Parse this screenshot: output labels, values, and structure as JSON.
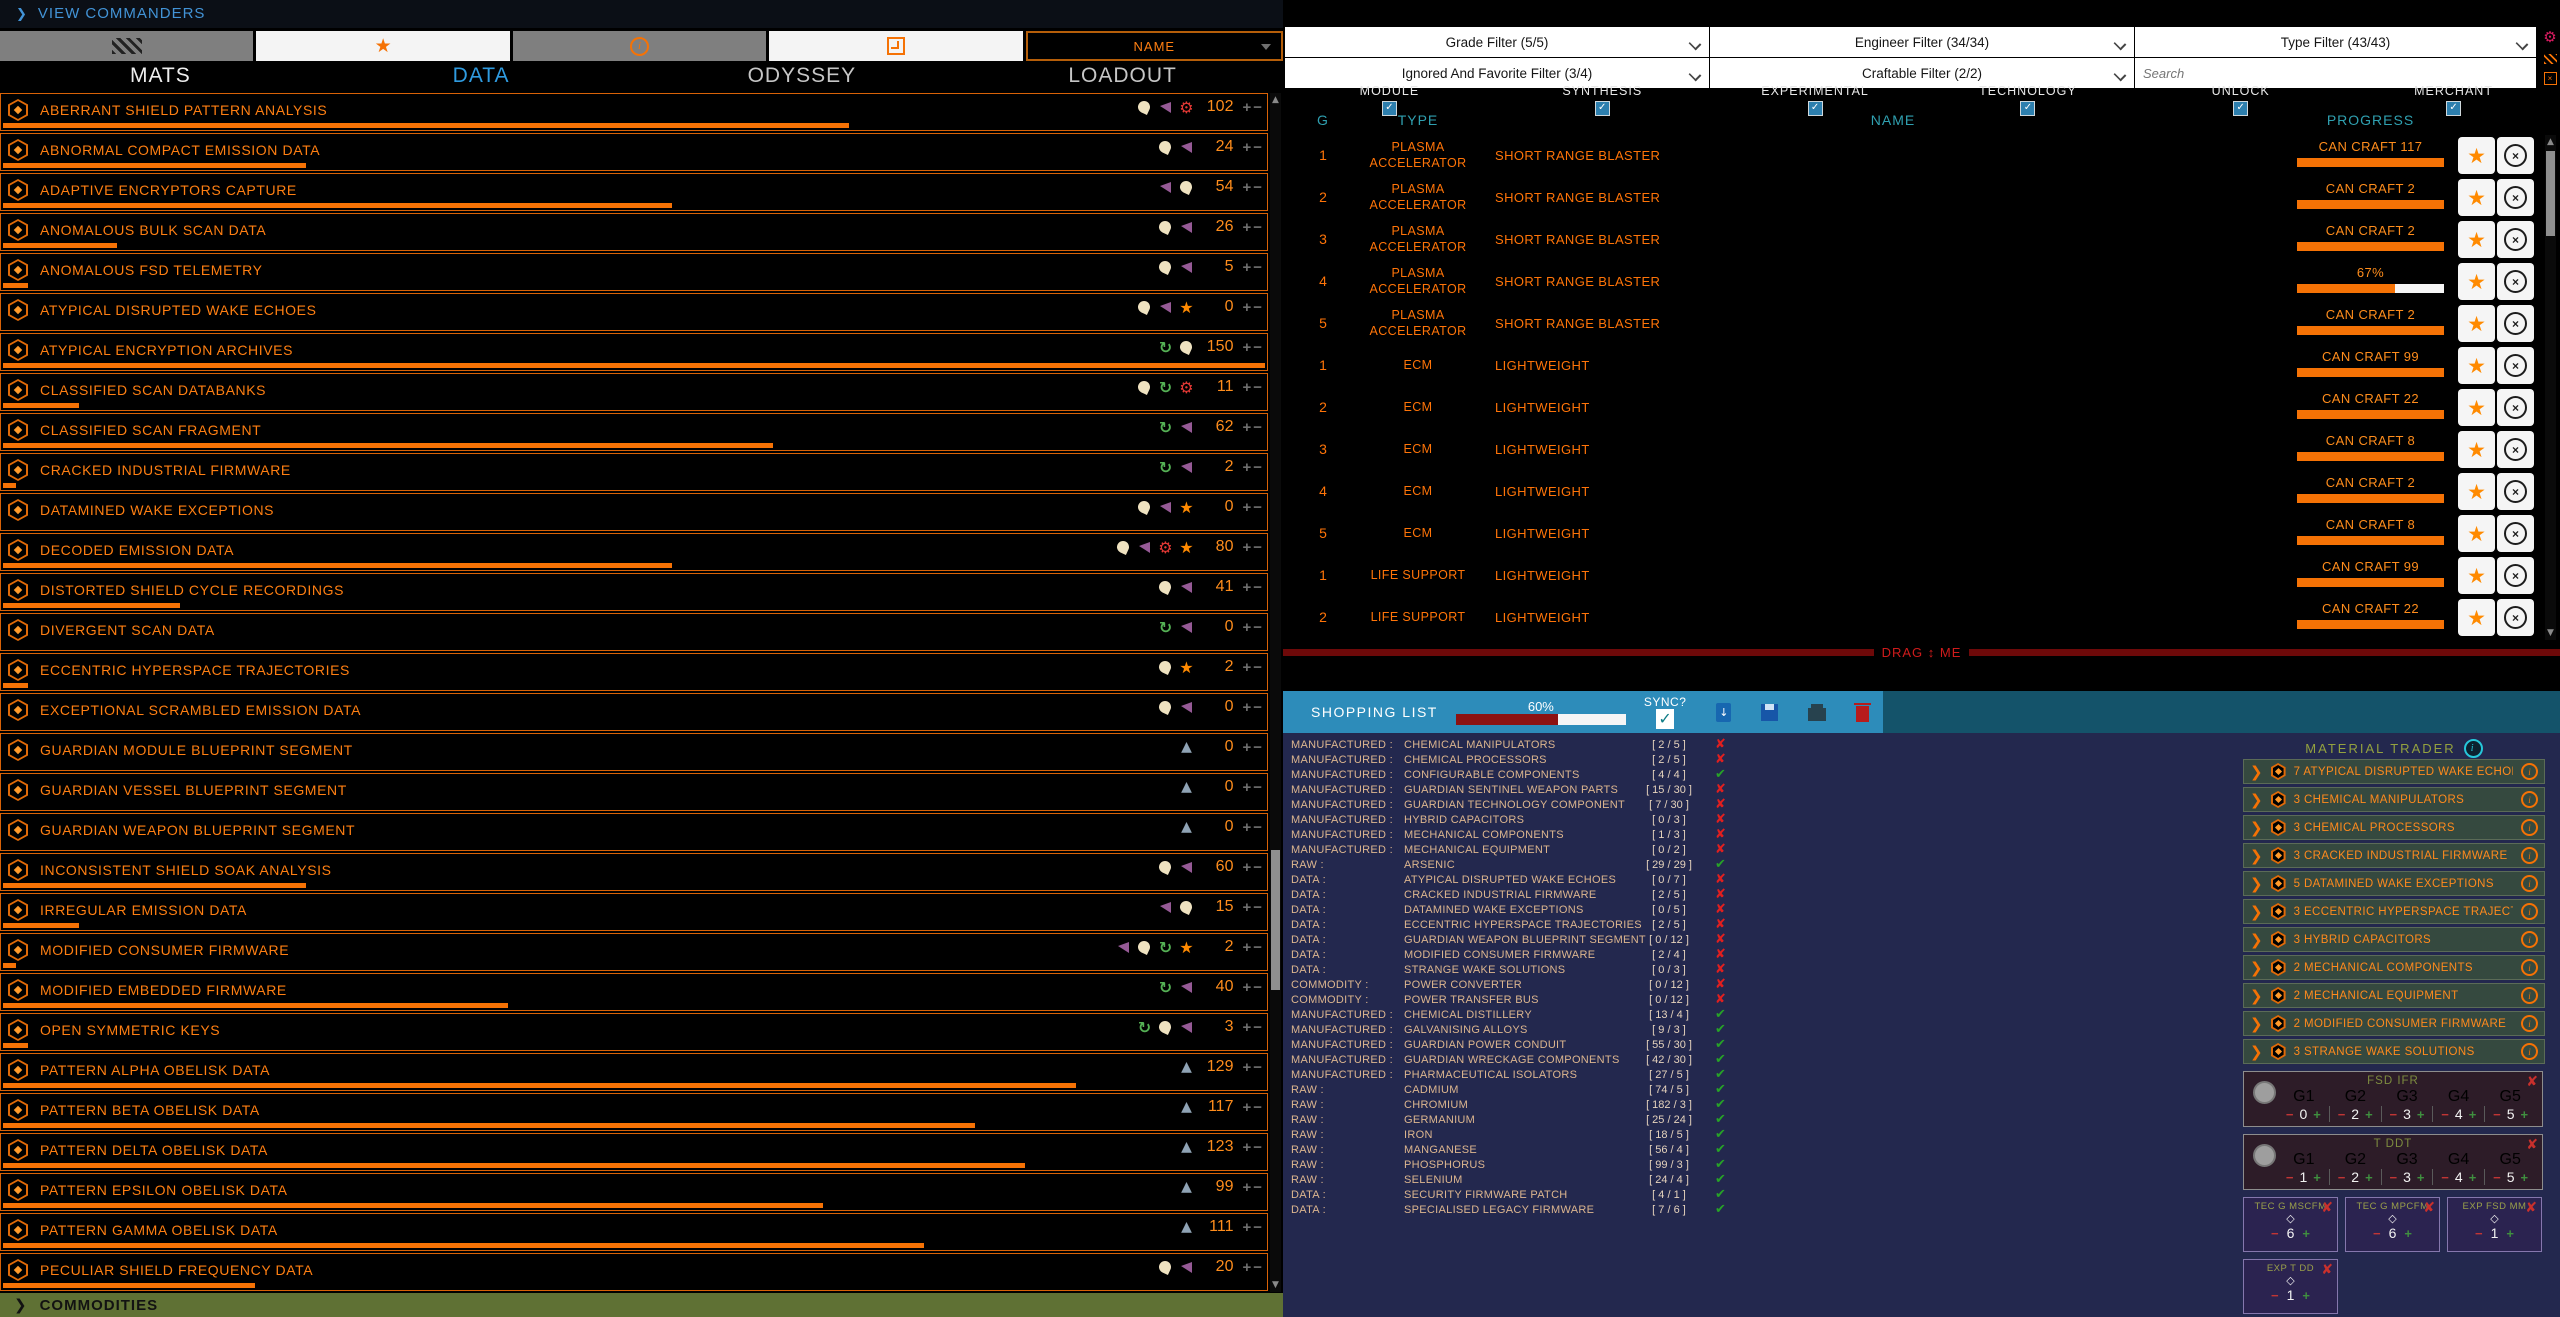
{
  "top": {
    "view_commanders": "VIEW COMMANDERS"
  },
  "toolbar": {
    "buttons": [
      {
        "icon": "hatch-icon"
      },
      {
        "icon": "star-icon"
      },
      {
        "icon": "info-icon"
      },
      {
        "icon": "box-icon"
      }
    ],
    "name_dropdown": "NAME"
  },
  "tabs": [
    {
      "label": "MATS",
      "active": false
    },
    {
      "label": "DATA",
      "active": true
    },
    {
      "label": "ODYSSEY",
      "active": false
    },
    {
      "label": "LOADOUT",
      "active": false
    }
  ],
  "materials": [
    {
      "name": "ABERRANT SHIELD PATTERN ANALYSIS",
      "icons": [
        "satellite",
        "flag",
        "gear"
      ],
      "count": 102,
      "progress": 67
    },
    {
      "name": "ABNORMAL COMPACT EMISSION DATA",
      "icons": [
        "satellite",
        "flag"
      ],
      "count": 24,
      "progress": 24
    },
    {
      "name": "ADAPTIVE ENCRYPTORS CAPTURE",
      "icons": [
        "flag",
        "satellite"
      ],
      "count": 54,
      "progress": 53
    },
    {
      "name": "ANOMALOUS BULK SCAN DATA",
      "icons": [
        "satellite",
        "flag"
      ],
      "count": 26,
      "progress": 9
    },
    {
      "name": "ANOMALOUS FSD TELEMETRY",
      "icons": [
        "satellite",
        "flag"
      ],
      "count": 5,
      "progress": 2
    },
    {
      "name": "ATYPICAL DISRUPTED WAKE ECHOES",
      "icons": [
        "satellite",
        "flag",
        "star"
      ],
      "count": 0,
      "progress": 0
    },
    {
      "name": "ATYPICAL ENCRYPTION ARCHIVES",
      "icons": [
        "trade",
        "satellite"
      ],
      "count": 150,
      "progress": 100
    },
    {
      "name": "CLASSIFIED SCAN DATABANKS",
      "icons": [
        "satellite",
        "trade",
        "gear"
      ],
      "count": 11,
      "progress": 6
    },
    {
      "name": "CLASSIFIED SCAN FRAGMENT",
      "icons": [
        "trade",
        "flag"
      ],
      "count": 62,
      "progress": 61
    },
    {
      "name": "CRACKED INDUSTRIAL FIRMWARE",
      "icons": [
        "trade",
        "flag"
      ],
      "count": 2,
      "progress": 1
    },
    {
      "name": "DATAMINED WAKE EXCEPTIONS",
      "icons": [
        "satellite",
        "flag",
        "star"
      ],
      "count": 0,
      "progress": 0
    },
    {
      "name": "DECODED EMISSION DATA",
      "icons": [
        "satellite",
        "flag",
        "gear",
        "star"
      ],
      "count": 80,
      "progress": 53
    },
    {
      "name": "DISTORTED SHIELD CYCLE RECORDINGS",
      "icons": [
        "satellite",
        "flag"
      ],
      "count": 41,
      "progress": 14
    },
    {
      "name": "DIVERGENT SCAN DATA",
      "icons": [
        "trade",
        "flag"
      ],
      "count": 0,
      "progress": 0
    },
    {
      "name": "ECCENTRIC HYPERSPACE TRAJECTORIES",
      "icons": [
        "satellite",
        "star"
      ],
      "count": 2,
      "progress": 2
    },
    {
      "name": "EXCEPTIONAL SCRAMBLED EMISSION DATA",
      "icons": [
        "satellite",
        "flag"
      ],
      "count": 0,
      "progress": 0
    },
    {
      "name": "GUARDIAN MODULE BLUEPRINT SEGMENT",
      "icons": [
        "guardian"
      ],
      "count": 0,
      "progress": 0
    },
    {
      "name": "GUARDIAN VESSEL BLUEPRINT SEGMENT",
      "icons": [
        "guardian"
      ],
      "count": 0,
      "progress": 0
    },
    {
      "name": "GUARDIAN WEAPON BLUEPRINT SEGMENT",
      "icons": [
        "guardian"
      ],
      "count": 0,
      "progress": 0
    },
    {
      "name": "INCONSISTENT SHIELD SOAK ANALYSIS",
      "icons": [
        "satellite",
        "flag"
      ],
      "count": 60,
      "progress": 24
    },
    {
      "name": "IRREGULAR EMISSION DATA",
      "icons": [
        "flag",
        "satellite"
      ],
      "count": 15,
      "progress": 6
    },
    {
      "name": "MODIFIED CONSUMER FIRMWARE",
      "icons": [
        "flag",
        "satellite",
        "trade",
        "star"
      ],
      "count": 2,
      "progress": 1
    },
    {
      "name": "MODIFIED EMBEDDED FIRMWARE",
      "icons": [
        "trade",
        "flag"
      ],
      "count": 40,
      "progress": 40
    },
    {
      "name": "OPEN SYMMETRIC KEYS",
      "icons": [
        "trade",
        "satellite",
        "flag"
      ],
      "count": 3,
      "progress": 2
    },
    {
      "name": "PATTERN ALPHA OBELISK DATA",
      "icons": [
        "guardian"
      ],
      "count": 129,
      "progress": 85
    },
    {
      "name": "PATTERN BETA OBELISK DATA",
      "icons": [
        "guardian"
      ],
      "count": 117,
      "progress": 77
    },
    {
      "name": "PATTERN DELTA OBELISK DATA",
      "icons": [
        "guardian"
      ],
      "count": 123,
      "progress": 81
    },
    {
      "name": "PATTERN EPSILON OBELISK DATA",
      "icons": [
        "guardian"
      ],
      "count": 99,
      "progress": 65
    },
    {
      "name": "PATTERN GAMMA OBELISK DATA",
      "icons": [
        "guardian"
      ],
      "count": 111,
      "progress": 73
    },
    {
      "name": "PECULIAR SHIELD FREQUENCY DATA",
      "icons": [
        "satellite",
        "flag"
      ],
      "count": 20,
      "progress": 20
    }
  ],
  "commodities_label": "COMMODITIES",
  "filters": {
    "grade": "Grade Filter (5/5)",
    "engineer": "Engineer Filter (34/34)",
    "type": "Type Filter (43/43)",
    "ignored": "Ignored And Favorite Filter (3/4)",
    "craftable": "Craftable Filter (2/2)",
    "search_placeholder": "Search"
  },
  "categories": [
    "MODULE",
    "SYNTHESIS",
    "EXPERIMENTAL",
    "TECHNOLOGY",
    "UNLOCK",
    "MERCHANT"
  ],
  "table": {
    "headers": {
      "g": "G",
      "type": "TYPE",
      "name": "NAME",
      "progress": "PROGRESS"
    },
    "rows": [
      {
        "g": "1",
        "type": "PLASMA ACCELERATOR",
        "subtype": "SHORT RANGE BLASTER",
        "name": "",
        "progress_label": "CAN CRAFT 117",
        "progress_pct": 100
      },
      {
        "g": "2",
        "type": "PLASMA ACCELERATOR",
        "subtype": "SHORT RANGE BLASTER",
        "name": "",
        "progress_label": "CAN CRAFT 2",
        "progress_pct": 100
      },
      {
        "g": "3",
        "type": "PLASMA ACCELERATOR",
        "subtype": "SHORT RANGE BLASTER",
        "name": "",
        "progress_label": "CAN CRAFT 2",
        "progress_pct": 100
      },
      {
        "g": "4",
        "type": "PLASMA ACCELERATOR",
        "subtype": "SHORT RANGE BLASTER",
        "name": "",
        "progress_label": "67%",
        "progress_pct": 67
      },
      {
        "g": "5",
        "type": "PLASMA ACCELERATOR",
        "subtype": "SHORT RANGE BLASTER",
        "name": "",
        "progress_label": "CAN CRAFT 2",
        "progress_pct": 100
      },
      {
        "g": "1",
        "type": "ECM",
        "subtype": "LIGHTWEIGHT",
        "name": "",
        "progress_label": "CAN CRAFT 99",
        "progress_pct": 100
      },
      {
        "g": "2",
        "type": "ECM",
        "subtype": "LIGHTWEIGHT",
        "name": "",
        "progress_label": "CAN CRAFT 22",
        "progress_pct": 100
      },
      {
        "g": "3",
        "type": "ECM",
        "subtype": "LIGHTWEIGHT",
        "name": "",
        "progress_label": "CAN CRAFT 8",
        "progress_pct": 100
      },
      {
        "g": "4",
        "type": "ECM",
        "subtype": "LIGHTWEIGHT",
        "name": "",
        "progress_label": "CAN CRAFT 2",
        "progress_pct": 100
      },
      {
        "g": "5",
        "type": "ECM",
        "subtype": "LIGHTWEIGHT",
        "name": "",
        "progress_label": "CAN CRAFT 8",
        "progress_pct": 100
      },
      {
        "g": "1",
        "type": "LIFE SUPPORT",
        "subtype": "LIGHTWEIGHT",
        "name": "",
        "progress_label": "CAN CRAFT 99",
        "progress_pct": 100
      },
      {
        "g": "2",
        "type": "LIFE SUPPORT",
        "subtype": "LIGHTWEIGHT",
        "name": "",
        "progress_label": "CAN CRAFT 22",
        "progress_pct": 100
      }
    ]
  },
  "splitter_label": "DRAG ↕ ME",
  "shopping": {
    "title": "SHOPPING LIST",
    "progress_label": "60%",
    "progress_pct": 60,
    "sync_label": "SYNC?",
    "items": [
      {
        "category": "MANUFACTURED :",
        "name": "CHEMICAL MANIPULATORS",
        "qty": "[ 2 / 5 ]",
        "ok": false
      },
      {
        "category": "MANUFACTURED :",
        "name": "CHEMICAL PROCESSORS",
        "qty": "[ 2 / 5 ]",
        "ok": false
      },
      {
        "category": "MANUFACTURED :",
        "name": "CONFIGURABLE COMPONENTS",
        "qty": "[ 4 / 4 ]",
        "ok": true
      },
      {
        "category": "MANUFACTURED :",
        "name": "GUARDIAN SENTINEL WEAPON PARTS",
        "qty": "[ 15 / 30 ]",
        "ok": false
      },
      {
        "category": "MANUFACTURED :",
        "name": "GUARDIAN TECHNOLOGY COMPONENT",
        "qty": "[ 7 / 30 ]",
        "ok": false
      },
      {
        "category": "MANUFACTURED :",
        "name": "HYBRID CAPACITORS",
        "qty": "[ 0 / 3 ]",
        "ok": false
      },
      {
        "category": "MANUFACTURED :",
        "name": "MECHANICAL COMPONENTS",
        "qty": "[ 1 / 3 ]",
        "ok": false
      },
      {
        "category": "MANUFACTURED :",
        "name": "MECHANICAL EQUIPMENT",
        "qty": "[ 0 / 2 ]",
        "ok": false
      },
      {
        "category": "RAW :",
        "name": "ARSENIC",
        "qty": "[ 29 / 29 ]",
        "ok": true
      },
      {
        "category": "DATA :",
        "name": "ATYPICAL DISRUPTED WAKE ECHOES",
        "qty": "[ 0 / 7 ]",
        "ok": false
      },
      {
        "category": "DATA :",
        "name": "CRACKED INDUSTRIAL FIRMWARE",
        "qty": "[ 2 / 5 ]",
        "ok": false
      },
      {
        "category": "DATA :",
        "name": "DATAMINED WAKE EXCEPTIONS",
        "qty": "[ 0 / 5 ]",
        "ok": false
      },
      {
        "category": "DATA :",
        "name": "ECCENTRIC HYPERSPACE TRAJECTORIES",
        "qty": "[ 2 / 5 ]",
        "ok": false
      },
      {
        "category": "DATA :",
        "name": "GUARDIAN WEAPON BLUEPRINT SEGMENT",
        "qty": "[ 0 / 12 ]",
        "ok": false
      },
      {
        "category": "DATA :",
        "name": "MODIFIED CONSUMER FIRMWARE",
        "qty": "[ 2 / 4 ]",
        "ok": false
      },
      {
        "category": "DATA :",
        "name": "STRANGE WAKE SOLUTIONS",
        "qty": "[ 0 / 3 ]",
        "ok": false
      },
      {
        "category": "COMMODITY :",
        "name": "POWER CONVERTER",
        "qty": "[ 0 / 12 ]",
        "ok": false
      },
      {
        "category": "COMMODITY :",
        "name": "POWER TRANSFER BUS",
        "qty": "[ 0 / 12 ]",
        "ok": false
      },
      {
        "category": "MANUFACTURED :",
        "name": "CHEMICAL DISTILLERY",
        "qty": "[ 13 / 4 ]",
        "ok": true
      },
      {
        "category": "MANUFACTURED :",
        "name": "GALVANISING ALLOYS",
        "qty": "[ 9 / 3 ]",
        "ok": true
      },
      {
        "category": "MANUFACTURED :",
        "name": "GUARDIAN POWER CONDUIT",
        "qty": "[ 55 / 30 ]",
        "ok": true
      },
      {
        "category": "MANUFACTURED :",
        "name": "GUARDIAN WRECKAGE COMPONENTS",
        "qty": "[ 42 / 30 ]",
        "ok": true
      },
      {
        "category": "MANUFACTURED :",
        "name": "PHARMACEUTICAL ISOLATORS",
        "qty": "[ 27 / 5 ]",
        "ok": true
      },
      {
        "category": "RAW :",
        "name": "CADMIUM",
        "qty": "[ 74 / 5 ]",
        "ok": true
      },
      {
        "category": "RAW :",
        "name": "CHROMIUM",
        "qty": "[ 182 / 3 ]",
        "ok": true
      },
      {
        "category": "RAW :",
        "name": "GERMANIUM",
        "qty": "[ 25 / 24 ]",
        "ok": true
      },
      {
        "category": "RAW :",
        "name": "IRON",
        "qty": "[ 18 / 5 ]",
        "ok": true
      },
      {
        "category": "RAW :",
        "name": "MANGANESE",
        "qty": "[ 56 / 4 ]",
        "ok": true
      },
      {
        "category": "RAW :",
        "name": "PHOSPHORUS",
        "qty": "[ 99 / 3 ]",
        "ok": true
      },
      {
        "category": "RAW :",
        "name": "SELENIUM",
        "qty": "[ 24 / 4 ]",
        "ok": true
      },
      {
        "category": "DATA :",
        "name": "SECURITY FIRMWARE PATCH",
        "qty": "[ 4 / 1 ]",
        "ok": true
      },
      {
        "category": "DATA :",
        "name": "SPECIALISED LEGACY FIRMWARE",
        "qty": "[ 7 / 6 ]",
        "ok": true
      }
    ]
  },
  "trader": {
    "title": "MATERIAL TRADER",
    "items": [
      {
        "count": "7",
        "name": "ATYPICAL DISRUPTED WAKE ECHOES"
      },
      {
        "count": "3",
        "name": "CHEMICAL MANIPULATORS"
      },
      {
        "count": "3",
        "name": "CHEMICAL PROCESSORS"
      },
      {
        "count": "3",
        "name": "CRACKED INDUSTRIAL FIRMWARE"
      },
      {
        "count": "5",
        "name": "DATAMINED WAKE EXCEPTIONS"
      },
      {
        "count": "3",
        "name": "ECCENTRIC HYPERSPACE TRAJECTORIES"
      },
      {
        "count": "3",
        "name": "HYBRID CAPACITORS"
      },
      {
        "count": "2",
        "name": "MECHANICAL COMPONENTS"
      },
      {
        "count": "2",
        "name": "MECHANICAL EQUIPMENT"
      },
      {
        "count": "2",
        "name": "MODIFIED CONSUMER FIRMWARE"
      },
      {
        "count": "3",
        "name": "STRANGE WAKE SOLUTIONS"
      }
    ]
  },
  "grade_cards": [
    {
      "title": "FSD IFR",
      "grades": [
        "G1",
        "G2",
        "G3",
        "G4",
        "G5"
      ],
      "values": [
        "0",
        "2",
        "3",
        "4",
        "5"
      ]
    },
    {
      "title": "T DDT",
      "grades": [
        "G1",
        "G2",
        "G3",
        "G4",
        "G5"
      ],
      "values": [
        "1",
        "2",
        "3",
        "4",
        "5"
      ]
    }
  ],
  "exp_cards": [
    {
      "title": "TEC G MSCFM",
      "value": "6"
    },
    {
      "title": "TEC G MPCFM",
      "value": "6"
    },
    {
      "title": "EXP FSD MM",
      "value": "1"
    },
    {
      "title": "EXP T DD",
      "value": "1"
    }
  ],
  "colors": {
    "accent_orange": "#f57205",
    "accent_blue": "#2f9be0",
    "navy": "#23284e",
    "header_blue": "#2d8cba"
  }
}
